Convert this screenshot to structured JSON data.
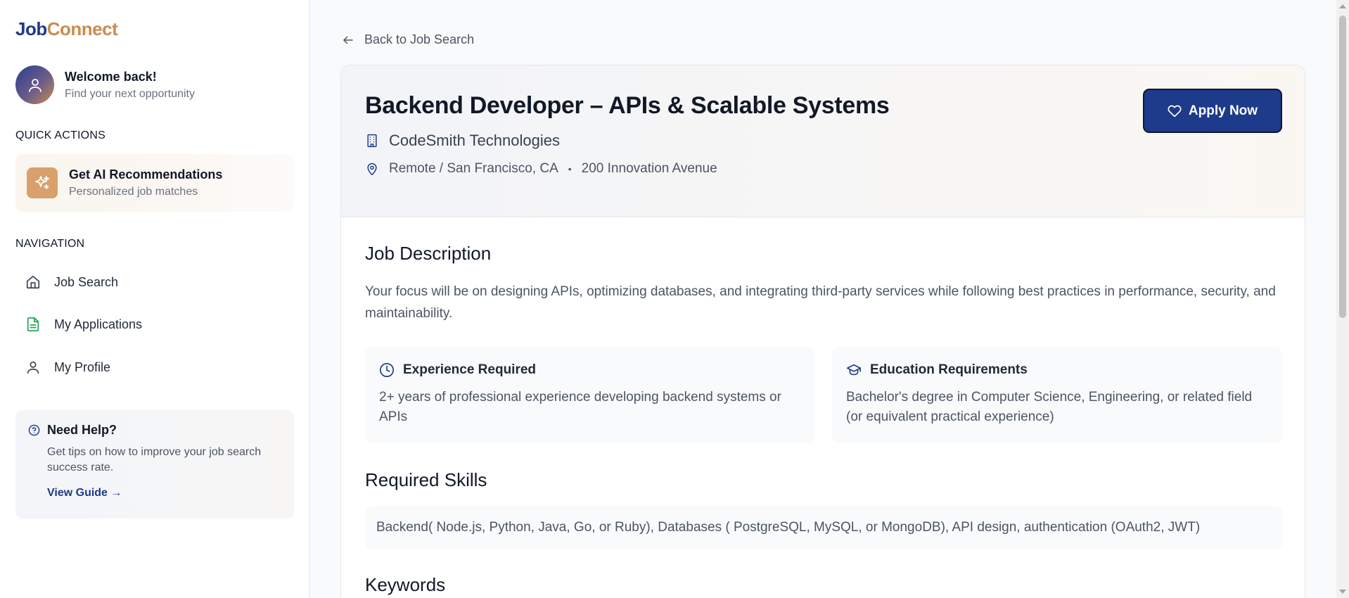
{
  "brand": {
    "part1": "Job",
    "part2": "Connect"
  },
  "user": {
    "welcome": "Welcome back!",
    "subtitle": "Find your next opportunity"
  },
  "sidebar": {
    "quick_actions_label": "QUICK ACTIONS",
    "ai_card": {
      "title": "Get AI Recommendations",
      "subtitle": "Personalized job matches",
      "icon": "sparkles-icon"
    },
    "navigation_label": "NAVIGATION",
    "nav": [
      {
        "label": "Job Search",
        "icon": "home-icon"
      },
      {
        "label": "My Applications",
        "icon": "document-icon"
      },
      {
        "label": "My Profile",
        "icon": "user-icon"
      }
    ],
    "help": {
      "title": "Need Help?",
      "text": "Get tips on how to improve your job search success rate.",
      "link": "View Guide →"
    }
  },
  "main": {
    "back_label": "Back to Job Search",
    "job": {
      "title": "Backend Developer – APIs & Scalable Systems",
      "company": "CodeSmith Technologies",
      "location": "Remote / San Francisco, CA",
      "address": "200 Innovation Avenue",
      "apply_label": "Apply Now"
    },
    "description": {
      "heading": "Job Description",
      "text": "Your focus will be on designing APIs, optimizing databases, and integrating third-party services while following best practices in performance, security, and maintainability."
    },
    "experience": {
      "title": "Experience Required",
      "text": "2+ years of professional experience developing backend systems or APIs"
    },
    "education": {
      "title": "Education Requirements",
      "text": "Bachelor's degree in Computer Science, Engineering, or related field (or equivalent practical experience)"
    },
    "skills": {
      "heading": "Required Skills",
      "text": "Backend( Node.js, Python, Java, Go, or Ruby), Databases ( PostgreSQL, MySQL, or MongoDB), API design, authentication (OAuth2, JWT)"
    },
    "keywords_heading": "Keywords"
  },
  "colors": {
    "brand_navy": "#1e3a8a",
    "brand_gold": "#c98d4f",
    "apply_button": "#1e3a8a",
    "applications_icon": "#16a34a"
  }
}
